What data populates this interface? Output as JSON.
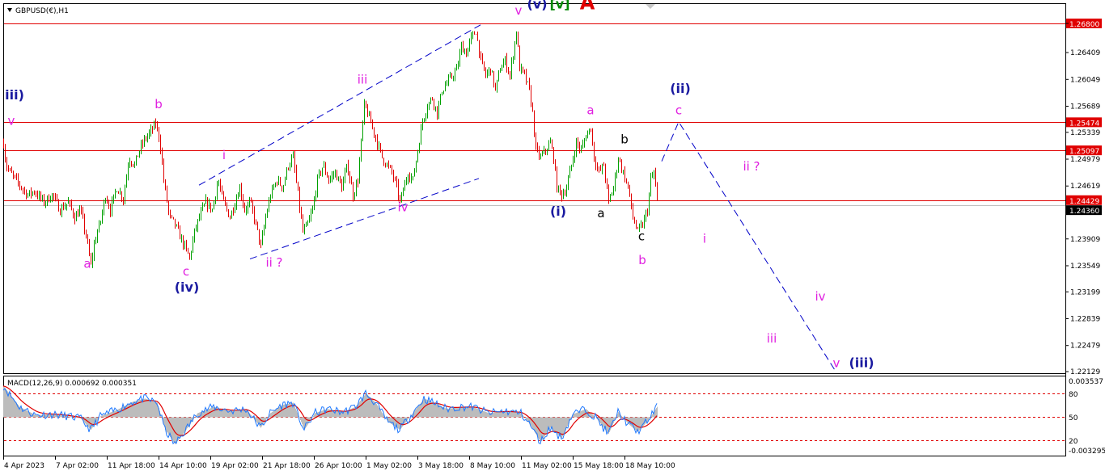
{
  "window": {
    "symbol_title": "GBPUSD(€),H1"
  },
  "indicator": {
    "title": "MACD(12,26,9) 0.000692 0.000351",
    "axis_labels": [
      "0.003537",
      "80",
      "50",
      "20",
      "-0.003295"
    ]
  },
  "colors": {
    "bull_candle": "#00a000",
    "bear_candle": "#e00000",
    "resistance_line": "#e00000",
    "trend_channel": "#0000c8",
    "wave_magenta": "#e020e0",
    "wave_navy": "#1a1aa0",
    "wave_green": "#008800",
    "wave_red": "#e00000",
    "macd_hist": "#bcbcbc",
    "macd_main": "#1e78ff",
    "macd_signal": "#e00000",
    "price_tag_bg": "#e00000",
    "current_price_bg": "#000000"
  },
  "chart_data": {
    "type": "candlestick",
    "symbol": "GBPUSD",
    "timeframe": "H1",
    "price_axis_ticks": [
      1.268,
      1.26409,
      1.26049,
      1.25689,
      1.25339,
      1.24979,
      1.24619,
      1.24269,
      1.23909,
      1.23549,
      1.23199,
      1.22839,
      1.22479,
      1.22129
    ],
    "time_axis_labels": [
      "4 Apr 2023",
      "7 Apr 02:00",
      "11 Apr 18:00",
      "14 Apr 10:00",
      "19 Apr 02:00",
      "21 Apr 18:00",
      "26 Apr 10:00",
      "1 May 02:00",
      "3 May 18:00",
      "8 May 10:00",
      "11 May 02:00",
      "15 May 18:00",
      "18 May 10:00"
    ],
    "horizontal_levels": [
      {
        "label": "1.26800",
        "price": 1.268
      },
      {
        "label": "1.25474",
        "price": 1.25474
      },
      {
        "label": "1.25097",
        "price": 1.25097
      },
      {
        "label": "1.24429",
        "price": 1.24429
      }
    ],
    "current_price": {
      "label": "1.24360",
      "price": 1.2436
    },
    "price_path": [
      [
        0,
        1.252
      ],
      [
        3,
        1.249
      ],
      [
        8,
        1.248
      ],
      [
        15,
        1.247
      ],
      [
        22,
        1.246
      ],
      [
        30,
        1.245
      ],
      [
        38,
        1.2455
      ],
      [
        50,
        1.244
      ],
      [
        60,
        1.245
      ],
      [
        70,
        1.243
      ],
      [
        80,
        1.244
      ],
      [
        88,
        1.242
      ],
      [
        95,
        1.243
      ],
      [
        102,
        1.2395
      ],
      [
        108,
        1.2355
      ],
      [
        113,
        1.239
      ],
      [
        120,
        1.2415
      ],
      [
        126,
        1.245
      ],
      [
        132,
        1.243
      ],
      [
        140,
        1.246
      ],
      [
        148,
        1.2445
      ],
      [
        155,
        1.25
      ],
      [
        162,
        1.249
      ],
      [
        168,
        1.251
      ],
      [
        175,
        1.2525
      ],
      [
        182,
        1.2535
      ],
      [
        188,
        1.2545
      ],
      [
        193,
        1.2525
      ],
      [
        198,
        1.247
      ],
      [
        205,
        1.242
      ],
      [
        212,
        1.241
      ],
      [
        218,
        1.2395
      ],
      [
        224,
        1.238
      ],
      [
        230,
        1.2365
      ],
      [
        236,
        1.24
      ],
      [
        242,
        1.242
      ],
      [
        250,
        1.244
      ],
      [
        258,
        1.243
      ],
      [
        265,
        1.247
      ],
      [
        272,
        1.244
      ],
      [
        280,
        1.242
      ],
      [
        286,
        1.244
      ],
      [
        292,
        1.246
      ],
      [
        298,
        1.243
      ],
      [
        305,
        1.244
      ],
      [
        312,
        1.241
      ],
      [
        318,
        1.238
      ],
      [
        324,
        1.242
      ],
      [
        330,
        1.245
      ],
      [
        338,
        1.247
      ],
      [
        345,
        1.246
      ],
      [
        352,
        1.249
      ],
      [
        358,
        1.25
      ],
      [
        364,
        1.245
      ],
      [
        370,
        1.24
      ],
      [
        376,
        1.241
      ],
      [
        382,
        1.243
      ],
      [
        388,
        1.247
      ],
      [
        395,
        1.249
      ],
      [
        402,
        1.247
      ],
      [
        410,
        1.248
      ],
      [
        418,
        1.246
      ],
      [
        425,
        1.249
      ],
      [
        432,
        1.245
      ],
      [
        438,
        1.247
      ],
      [
        442,
        1.252
      ],
      [
        446,
        1.257
      ],
      [
        450,
        1.256
      ],
      [
        456,
        1.254
      ],
      [
        462,
        1.252
      ],
      [
        468,
        1.25
      ],
      [
        474,
        1.249
      ],
      [
        480,
        1.248
      ],
      [
        486,
        1.246
      ],
      [
        490,
        1.244
      ],
      [
        495,
        1.246
      ],
      [
        500,
        1.248
      ],
      [
        506,
        1.247
      ],
      [
        512,
        1.251
      ],
      [
        518,
        1.255
      ],
      [
        524,
        1.257
      ],
      [
        530,
        1.258
      ],
      [
        536,
        1.256
      ],
      [
        542,
        1.259
      ],
      [
        548,
        1.26
      ],
      [
        555,
        1.261
      ],
      [
        561,
        1.262
      ],
      [
        566,
        1.265
      ],
      [
        572,
        1.264
      ],
      [
        578,
        1.266
      ],
      [
        584,
        1.267
      ],
      [
        590,
        1.263
      ],
      [
        596,
        1.261
      ],
      [
        602,
        1.262
      ],
      [
        608,
        1.259
      ],
      [
        614,
        1.262
      ],
      [
        620,
        1.263
      ],
      [
        626,
        1.261
      ],
      [
        630,
        1.264
      ],
      [
        634,
        1.267
      ],
      [
        638,
        1.262
      ],
      [
        644,
        1.261
      ],
      [
        650,
        1.259
      ],
      [
        654,
        1.256
      ],
      [
        658,
        1.251
      ],
      [
        664,
        1.25
      ],
      [
        670,
        1.251
      ],
      [
        676,
        1.252
      ],
      [
        680,
        1.25
      ],
      [
        684,
        1.246
      ],
      [
        690,
        1.245
      ],
      [
        696,
        1.246
      ],
      [
        702,
        1.249
      ],
      [
        708,
        1.252
      ],
      [
        714,
        1.251
      ],
      [
        720,
        1.253
      ],
      [
        726,
        1.254
      ],
      [
        730,
        1.25
      ],
      [
        736,
        1.248
      ],
      [
        742,
        1.249
      ],
      [
        748,
        1.244
      ],
      [
        754,
        1.246
      ],
      [
        760,
        1.25
      ],
      [
        766,
        1.248
      ],
      [
        772,
        1.246
      ],
      [
        778,
        1.242
      ],
      [
        784,
        1.24
      ],
      [
        790,
        1.241
      ],
      [
        796,
        1.243
      ],
      [
        800,
        1.247
      ],
      [
        804,
        1.248
      ],
      [
        808,
        1.244
      ]
    ],
    "macd_path": [
      [
        0,
        0.003
      ],
      [
        20,
        0.001
      ],
      [
        40,
        0.0002
      ],
      [
        60,
        0.0003
      ],
      [
        80,
        0.0001
      ],
      [
        95,
        -0.0001
      ],
      [
        108,
        -0.0012
      ],
      [
        120,
        0.0001
      ],
      [
        140,
        0.0007
      ],
      [
        160,
        0.0015
      ],
      [
        175,
        0.0018
      ],
      [
        190,
        0.0014
      ],
      [
        200,
        -0.0012
      ],
      [
        212,
        -0.0026
      ],
      [
        224,
        -0.0014
      ],
      [
        240,
        0.0004
      ],
      [
        260,
        0.001
      ],
      [
        280,
        0.0006
      ],
      [
        300,
        0.0008
      ],
      [
        318,
        -0.001
      ],
      [
        330,
        0.0004
      ],
      [
        345,
        0.0012
      ],
      [
        358,
        0.0014
      ],
      [
        372,
        -0.0012
      ],
      [
        385,
        0.0004
      ],
      [
        400,
        0.0008
      ],
      [
        420,
        0.0005
      ],
      [
        435,
        0.001
      ],
      [
        448,
        0.0023
      ],
      [
        460,
        0.0014
      ],
      [
        475,
        -0.0004
      ],
      [
        490,
        -0.0012
      ],
      [
        505,
        0.0003
      ],
      [
        520,
        0.0018
      ],
      [
        532,
        0.0014
      ],
      [
        548,
        0.0008
      ],
      [
        565,
        0.001
      ],
      [
        580,
        0.001
      ],
      [
        600,
        0.0004
      ],
      [
        620,
        0.0006
      ],
      [
        640,
        0.0004
      ],
      [
        652,
        -0.0008
      ],
      [
        664,
        -0.0024
      ],
      [
        676,
        -0.001
      ],
      [
        690,
        -0.002
      ],
      [
        704,
        0.0003
      ],
      [
        720,
        0.0008
      ],
      [
        732,
        0.0
      ],
      [
        748,
        -0.0016
      ],
      [
        760,
        0.0005
      ],
      [
        772,
        -0.0006
      ],
      [
        784,
        -0.0014
      ],
      [
        796,
        -0.0004
      ],
      [
        808,
        0.001
      ]
    ],
    "trend_channel": [
      {
        "from": [
          242,
          1.2463
        ],
        "to": [
          590,
          1.2678
        ]
      },
      {
        "from": [
          305,
          1.2364
        ],
        "to": [
          588,
          1.2472
        ]
      }
    ],
    "projection_path": [
      [
        814,
        1.2495
      ],
      [
        835,
        1.2548
      ],
      [
        1028,
        1.2215
      ]
    ],
    "wave_labels": [
      {
        "text": "iii)",
        "bar": 14,
        "price": 1.2578,
        "color": "navy"
      },
      {
        "text": "v",
        "bar": 10,
        "price": 1.2544,
        "color": "magenta"
      },
      {
        "text": "a",
        "bar": 104,
        "price": 1.2352,
        "color": "magenta"
      },
      {
        "text": "b",
        "bar": 192,
        "price": 1.2566,
        "color": "magenta"
      },
      {
        "text": "c",
        "bar": 226,
        "price": 1.2342,
        "color": "magenta"
      },
      {
        "text": "(iv)",
        "bar": 227,
        "price": 1.232,
        "color": "navy"
      },
      {
        "text": "i",
        "bar": 273,
        "price": 1.2498,
        "color": "magenta"
      },
      {
        "text": "ii ?",
        "bar": 335,
        "price": 1.2354,
        "color": "magenta"
      },
      {
        "text": "iii",
        "bar": 444,
        "price": 1.2599,
        "color": "magenta"
      },
      {
        "text": "iv",
        "bar": 494,
        "price": 1.2428,
        "color": "magenta"
      },
      {
        "text": "v",
        "bar": 637,
        "price": 1.2692,
        "color": "magenta"
      },
      {
        "text": "(v)",
        "bar": 660,
        "price": 1.27,
        "color": "navy"
      },
      {
        "text": "[v]",
        "bar": 688,
        "price": 1.27,
        "color": "green"
      },
      {
        "text": "A",
        "bar": 722,
        "price": 1.2699,
        "color": "red"
      },
      {
        "text": "a",
        "bar": 726,
        "price": 1.2558,
        "color": "magenta"
      },
      {
        "text": "(i)",
        "bar": 686,
        "price": 1.2422,
        "color": "navy"
      },
      {
        "text": "a",
        "bar": 739,
        "price": 1.242,
        "color": "black"
      },
      {
        "text": "b",
        "bar": 768,
        "price": 1.2519,
        "color": "black"
      },
      {
        "text": "c",
        "bar": 789,
        "price": 1.2389,
        "color": "black"
      },
      {
        "text": "b",
        "bar": 790,
        "price": 1.2357,
        "color": "magenta"
      },
      {
        "text": "(ii)",
        "bar": 837,
        "price": 1.2587,
        "color": "navy"
      },
      {
        "text": "c",
        "bar": 835,
        "price": 1.2558,
        "color": "magenta"
      },
      {
        "text": "ii ?",
        "bar": 925,
        "price": 1.2483,
        "color": "magenta"
      },
      {
        "text": "i",
        "bar": 867,
        "price": 1.2386,
        "color": "magenta"
      },
      {
        "text": "iv",
        "bar": 1010,
        "price": 1.2308,
        "color": "magenta"
      },
      {
        "text": "iii",
        "bar": 950,
        "price": 1.2252,
        "color": "magenta"
      },
      {
        "text": "v",
        "bar": 1030,
        "price": 1.2219,
        "color": "magenta"
      },
      {
        "text": "(iii)",
        "bar": 1061,
        "price": 1.2219,
        "color": "navy"
      }
    ],
    "grid": false
  }
}
